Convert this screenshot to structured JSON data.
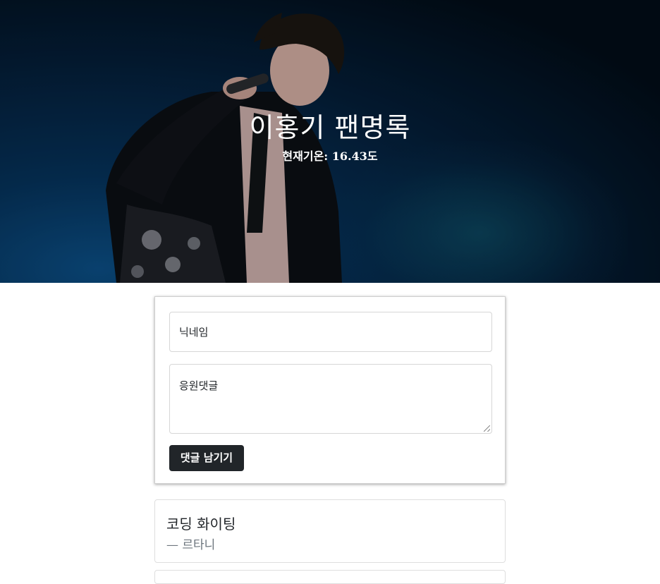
{
  "hero": {
    "title": "이홍기 팬명록",
    "weather": "현재기온: 16.43도"
  },
  "form": {
    "nickname_placeholder": "닉네임",
    "comment_placeholder": "응원댓글",
    "submit_label": "댓글 남기기"
  },
  "comments": [
    {
      "text": "코딩 화이팅",
      "author": "— 르타니"
    }
  ],
  "colors": {
    "button_bg": "#212529",
    "author_text": "#6c757d",
    "hero_bg": "#041e38"
  }
}
